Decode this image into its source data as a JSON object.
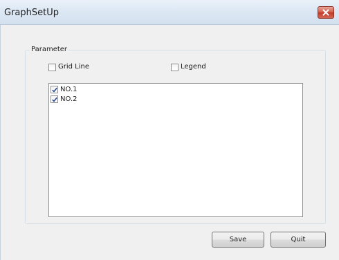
{
  "window": {
    "title": "GraphSetUp",
    "close_icon": "close-icon",
    "close_color": "#c13b27"
  },
  "parameter": {
    "group_label": "Parameter",
    "grid_line": {
      "label": "Grid Line",
      "checked": false
    },
    "legend": {
      "label": "Legend",
      "checked": false
    },
    "items": [
      {
        "label": "NO.1",
        "checked": true
      },
      {
        "label": "NO.2",
        "checked": true
      }
    ]
  },
  "buttons": {
    "save_label": "Save",
    "quit_label": "Quit"
  }
}
